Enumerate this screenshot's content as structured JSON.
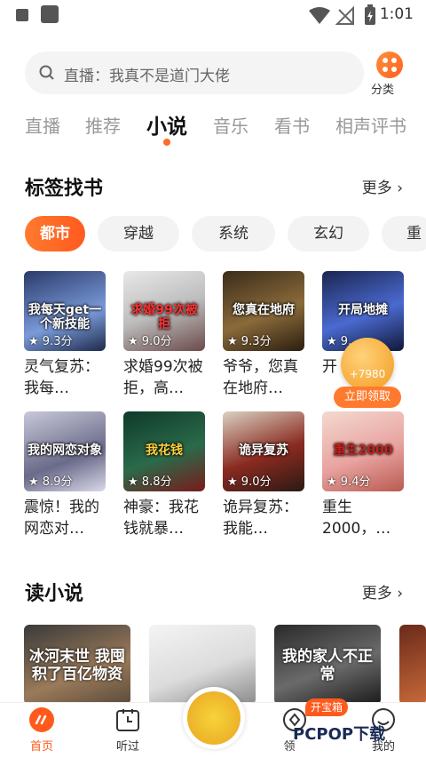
{
  "status_bar": {
    "time": "1:01"
  },
  "search": {
    "placeholder": "直播：我真不是道门大佬"
  },
  "category": {
    "label": "分类"
  },
  "tabs": [
    {
      "label": "直播"
    },
    {
      "label": "推荐"
    },
    {
      "label": "小说"
    },
    {
      "label": "音乐"
    },
    {
      "label": "看书"
    },
    {
      "label": "相声评书"
    }
  ],
  "tag_section": {
    "title": "标签找书",
    "more": "更多",
    "chips": [
      "都市",
      "穿越",
      "系统",
      "玄幻",
      "重"
    ],
    "books": [
      {
        "cover_text": "我每天get一个新技能",
        "rating": "9.3分",
        "name": "灵气复苏：我每…"
      },
      {
        "cover_text": "求婚99次被拒",
        "rating": "9.0分",
        "name": "求婚99次被拒，高…"
      },
      {
        "cover_text": "您真在地府",
        "rating": "9.3分",
        "name": "爷爷，您真在地府…"
      },
      {
        "cover_text": "开局地摊",
        "rating": "9.",
        "name": "开 卖"
      },
      {
        "cover_text": "我的网恋对象",
        "rating": "8.9分",
        "name": "震惊！我的网恋对…"
      },
      {
        "cover_text": "我花钱",
        "rating": "8.8分",
        "name": "神豪：我花钱就暴…"
      },
      {
        "cover_text": "诡异复苏",
        "rating": "9.0分",
        "name": "诡异复苏：我能…"
      },
      {
        "cover_text": "重生2000",
        "rating": "9.4分",
        "name": "重生2000，…"
      }
    ]
  },
  "reward": {
    "amount": "+7980",
    "button": "立即领取"
  },
  "read_section": {
    "title": "读小说",
    "more": "更多",
    "covers": [
      {
        "text": "冰河末世 我囤积了百亿物资"
      },
      {
        "text": ""
      },
      {
        "text": "我的家人不正常"
      },
      {
        "text": ""
      }
    ]
  },
  "bottom_nav": [
    {
      "label": "首页"
    },
    {
      "label": "听过"
    },
    {
      "label": "领"
    },
    {
      "label": "我的"
    }
  ],
  "treasure_badge": "开宝箱",
  "watermark": "PCPOP下载",
  "colors": {
    "accent": "#ff5a1e"
  }
}
